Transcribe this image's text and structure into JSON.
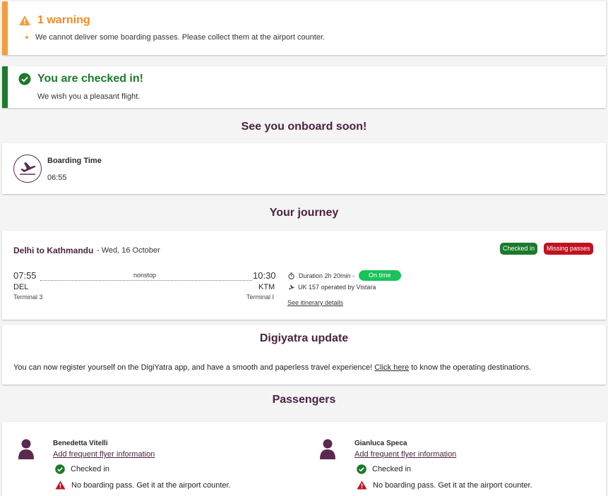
{
  "warning": {
    "title": "1 warning",
    "message": "We cannot deliver some boarding passes. Please collect them at the airport counter."
  },
  "success": {
    "title": "You are checked in!",
    "message": "We wish you a pleasant flight."
  },
  "headings": {
    "onboard": "See you onboard soon!",
    "journey": "Your journey",
    "passengers": "Passengers"
  },
  "boarding": {
    "label": "Boarding Time",
    "time": "06:55"
  },
  "journey": {
    "route": "Delhi to Kathmandu",
    "date": "- Wed, 16 October",
    "badges": {
      "checked_in": "Checked in",
      "missing": "Missing passes"
    },
    "departure": {
      "time": "07:55",
      "code": "DEL",
      "terminal": "Terminal 3"
    },
    "arrival": {
      "time": "10:30",
      "code": "KTM",
      "terminal": "Terminal I"
    },
    "stops": "nonstop",
    "duration": "Duration 2h 20min -",
    "status": "On time",
    "flight": "UK 157 operated by Vistara",
    "itinerary_link": "See itinerary details"
  },
  "digiyatra": {
    "title": "Digiyatra update",
    "text_before": "You can now register yourself on the DigiYatra app, and have a smooth and paperless travel experience! ",
    "link": "Click here",
    "text_after": " to know the operating destinations."
  },
  "passengers": [
    {
      "name": "Benedetta Vitelli",
      "ff_link": "Add frequent flyer information",
      "status": "Checked in",
      "warning": "No boarding pass. Get it at the airport counter."
    },
    {
      "name": "Gianluca Speca",
      "ff_link": "Add frequent flyer information",
      "status": "Checked in",
      "warning": "No boarding pass. Get it at the airport counter."
    }
  ],
  "colors": {
    "brand": "#4a2340",
    "success": "#1c7a2b",
    "warning": "#f59c3b",
    "danger": "#c0121f",
    "ontime": "#18c35a"
  }
}
